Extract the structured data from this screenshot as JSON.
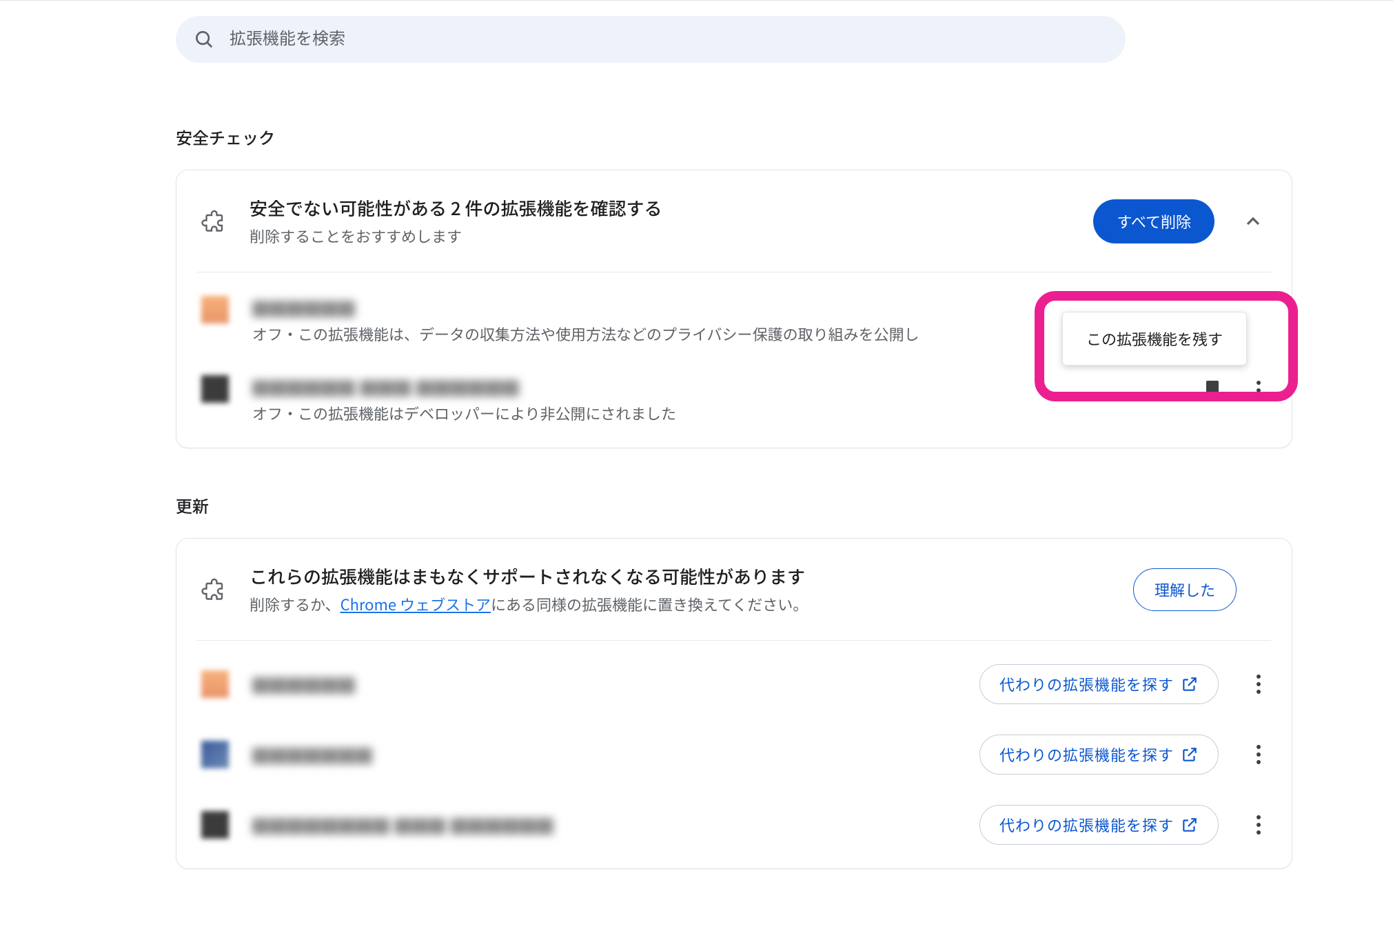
{
  "search": {
    "placeholder": "拡張機能を検索"
  },
  "safety": {
    "section_title": "安全チェック",
    "header_title": "安全でない可能性がある 2 件の拡張機能を確認する",
    "header_sub": "削除することをおすすめします",
    "remove_all": "すべて削除",
    "items": [
      {
        "name": "██████",
        "desc": "オフ・この拡張機能は、データの収集方法や使用方法などのプライバシー保護の取り組みを公開し"
      },
      {
        "name": "██████ ███ ██████",
        "desc": "オフ・この拡張機能はデベロッパーにより非公開にされました"
      }
    ],
    "popover": "この拡張機能を残す"
  },
  "updates": {
    "section_title": "更新",
    "header_title": "これらの拡張機能はまもなくサポートされなくなる可能性があります",
    "header_sub_pre": "削除するか、",
    "header_sub_link": "Chrome ウェブストア",
    "header_sub_post": "にある同様の拡張機能に置き換えてください。",
    "ack": "理解した",
    "find_alt": "代わりの拡張機能を探す",
    "items": [
      {
        "name": "██████"
      },
      {
        "name": "███████"
      },
      {
        "name": "████████ ███ ██████"
      }
    ]
  }
}
